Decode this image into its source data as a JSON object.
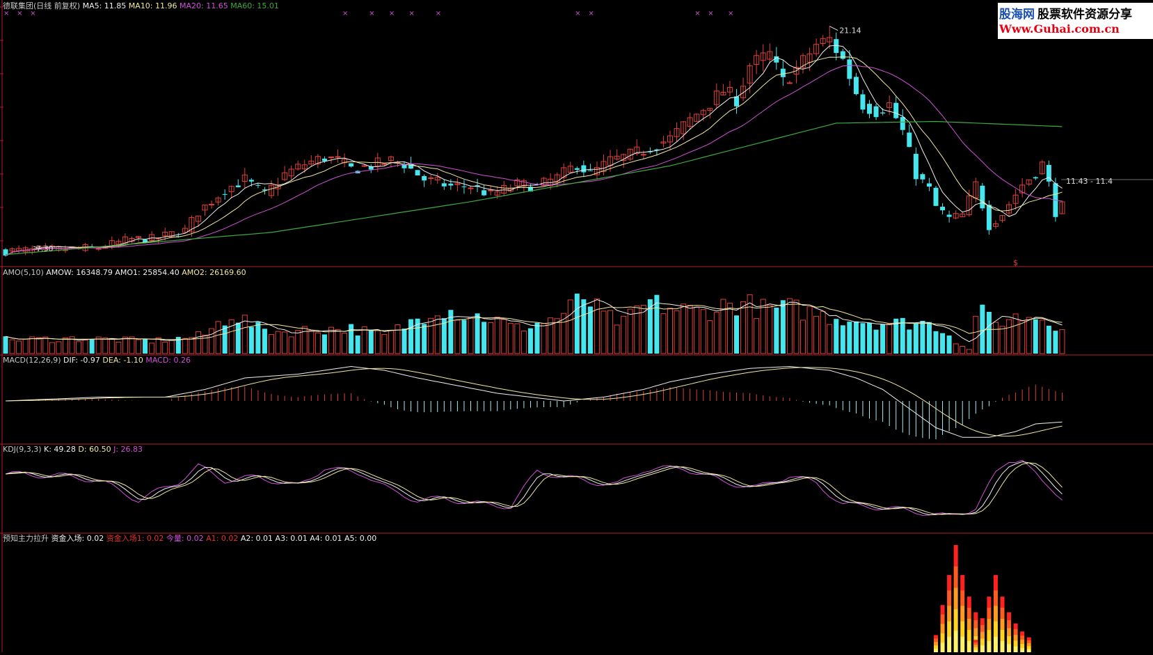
{
  "colors": {
    "bg": "#000000",
    "frame": "#b4222a",
    "up": "#e0403a",
    "down": "#46e6ef",
    "ma5": "#f0f0f0",
    "ma10": "#f3e9a0",
    "ma20": "#d052d8",
    "ma60": "#3faa3f",
    "yellow": "#e8e35a",
    "magenta": "#d052d8",
    "label": "#c8c8c8"
  },
  "watermark": {
    "brand_cn": "股海网",
    "slogan": "股票软件资源分享",
    "url": "Www.Guhai.com.cn"
  },
  "panels": {
    "main": {
      "title": "德联集团(日线 前复权)",
      "legend": [
        {
          "name": "MA5",
          "value": "11.85",
          "color": "#f0f0f0"
        },
        {
          "name": "MA10",
          "value": "11.96",
          "color": "#f3e9a0"
        },
        {
          "name": "MA20",
          "value": "11.65",
          "color": "#d052d8"
        },
        {
          "name": "MA60",
          "value": "15.01",
          "color": "#3faa3f"
        }
      ],
      "high_label": "21.14",
      "low_label": "7.30",
      "right_label": "11.43 - 11.4",
      "signal_mark": "$",
      "top_marks": [
        "×",
        "×",
        "×",
        "×",
        "×",
        "×",
        "×",
        "×",
        "×",
        "×",
        "×",
        "×",
        "×"
      ]
    },
    "amo": {
      "title": "AMO(5,10)",
      "legend": [
        {
          "name": "AMOW",
          "value": "16348.79",
          "color": "#f0f0f0"
        },
        {
          "name": "AMO1",
          "value": "25854.40",
          "color": "#f0f0f0"
        },
        {
          "name": "AMO2",
          "value": "26169.60",
          "color": "#f3e9a0"
        }
      ]
    },
    "macd": {
      "title": "MACD(12,26,9)",
      "legend": [
        {
          "name": "DIF",
          "value": "-0.97",
          "color": "#f0f0f0"
        },
        {
          "name": "DEA",
          "value": "-1.10",
          "color": "#f3e9a0"
        },
        {
          "name": "MACD",
          "value": "0.26",
          "color": "#d052d8"
        }
      ]
    },
    "kdj": {
      "title": "KDJ(9,3,3)",
      "legend": [
        {
          "name": "K",
          "value": "49.28",
          "color": "#f0f0f0"
        },
        {
          "name": "D",
          "value": "60.50",
          "color": "#f3e9a0"
        },
        {
          "name": "J",
          "value": "26.83",
          "color": "#d052d8"
        }
      ]
    },
    "fund": {
      "title": "预知主力拉升",
      "legend": [
        {
          "name": "资金入场",
          "value": "0.02",
          "color": "#f0f0f0"
        },
        {
          "name": "资金入场1",
          "value": "0.02",
          "color": "#e8302a"
        },
        {
          "name": "今量",
          "value": "0.02",
          "color": "#d052d8"
        },
        {
          "name": "A1",
          "value": "0.02",
          "color": "#e8302a"
        },
        {
          "name": "A2",
          "value": "0.01",
          "color": "#f0f0f0"
        },
        {
          "name": "A3",
          "value": "0.01",
          "color": "#f0f0f0"
        },
        {
          "name": "A4",
          "value": "0.01",
          "color": "#f0f0f0"
        },
        {
          "name": "A5",
          "value": "0.00",
          "color": "#f0f0f0"
        }
      ]
    }
  },
  "chart_data": {
    "type": "candlestick",
    "ylim": [
      7.0,
      21.6
    ],
    "anchor_price": [
      [
        0,
        7.7
      ],
      [
        8,
        7.8
      ],
      [
        14,
        7.9
      ],
      [
        19,
        8.4
      ],
      [
        22,
        8.4
      ],
      [
        27,
        8.9
      ],
      [
        29,
        10.0
      ],
      [
        33,
        11.3
      ],
      [
        36,
        11.9
      ],
      [
        39,
        11.0
      ],
      [
        42,
        12.2
      ],
      [
        45,
        12.8
      ],
      [
        48,
        13.2
      ],
      [
        50,
        13.0
      ],
      [
        52,
        12.5
      ],
      [
        55,
        12.7
      ],
      [
        58,
        13.0
      ],
      [
        60,
        12.8
      ],
      [
        63,
        11.9
      ],
      [
        67,
        11.5
      ],
      [
        70,
        11.5
      ],
      [
        73,
        11.0
      ],
      [
        77,
        11.6
      ],
      [
        80,
        11.5
      ],
      [
        83,
        12.0
      ],
      [
        86,
        12.8
      ],
      [
        88,
        12.2
      ],
      [
        91,
        13.0
      ],
      [
        93,
        13.2
      ],
      [
        96,
        13.6
      ],
      [
        100,
        14.3
      ],
      [
        103,
        15.4
      ],
      [
        106,
        16.4
      ],
      [
        108,
        17.1
      ],
      [
        110,
        16.6
      ],
      [
        112,
        18.6
      ],
      [
        115,
        19.2
      ],
      [
        117,
        17.6
      ],
      [
        120,
        18.8
      ],
      [
        122,
        19.8
      ],
      [
        124,
        20.1
      ],
      [
        126,
        18.9
      ],
      [
        128,
        17.0
      ],
      [
        129,
        16.3
      ],
      [
        131,
        15.9
      ],
      [
        133,
        16.3
      ],
      [
        135,
        14.7
      ],
      [
        137,
        12.2
      ],
      [
        139,
        11.3
      ],
      [
        140,
        10.3
      ],
      [
        142,
        9.6
      ],
      [
        144,
        9.8
      ],
      [
        146,
        11.6
      ],
      [
        148,
        9.2
      ],
      [
        150,
        9.9
      ],
      [
        153,
        11.6
      ],
      [
        155,
        12.3
      ],
      [
        156,
        12.8
      ],
      [
        157,
        11.6
      ],
      [
        158,
        10.0
      ],
      [
        159,
        10.3
      ]
    ],
    "ma60_anchors": [
      [
        0,
        7.5
      ],
      [
        40,
        8.8
      ],
      [
        70,
        10.6
      ],
      [
        100,
        12.7
      ],
      [
        125,
        15.2
      ],
      [
        140,
        15.3
      ],
      [
        159,
        15.0
      ]
    ],
    "amo_anchors": [
      [
        0,
        22
      ],
      [
        12,
        24
      ],
      [
        22,
        20
      ],
      [
        28,
        26
      ],
      [
        30,
        30
      ],
      [
        34,
        64
      ],
      [
        38,
        40
      ],
      [
        42,
        34
      ],
      [
        46,
        38
      ],
      [
        52,
        40
      ],
      [
        57,
        28
      ],
      [
        61,
        50
      ],
      [
        65,
        75
      ],
      [
        69,
        62
      ],
      [
        73,
        56
      ],
      [
        77,
        40
      ],
      [
        81,
        50
      ],
      [
        84,
        62
      ],
      [
        87,
        90
      ],
      [
        90,
        60
      ],
      [
        93,
        48
      ],
      [
        95,
        68
      ],
      [
        97,
        80
      ],
      [
        101,
        70
      ],
      [
        105,
        66
      ],
      [
        108,
        76
      ],
      [
        111,
        80
      ],
      [
        114,
        70
      ],
      [
        118,
        72
      ],
      [
        121,
        66
      ],
      [
        124,
        58
      ],
      [
        127,
        56
      ],
      [
        131,
        50
      ],
      [
        134,
        48
      ],
      [
        138,
        50
      ],
      [
        141,
        40
      ],
      [
        143,
        20
      ],
      [
        145,
        6
      ],
      [
        146,
        70
      ],
      [
        149,
        48
      ],
      [
        151,
        56
      ],
      [
        155,
        60
      ],
      [
        159,
        44
      ]
    ],
    "macd_anchors": [
      [
        0,
        0.0
      ],
      [
        14,
        0.1
      ],
      [
        24,
        0.1
      ],
      [
        30,
        0.3
      ],
      [
        36,
        0.6
      ],
      [
        44,
        0.7
      ],
      [
        52,
        0.9
      ],
      [
        57,
        0.8
      ],
      [
        62,
        0.6
      ],
      [
        68,
        0.4
      ],
      [
        74,
        0.2
      ],
      [
        79,
        0.1
      ],
      [
        84,
        0.0
      ],
      [
        90,
        0.1
      ],
      [
        96,
        0.3
      ],
      [
        100,
        0.5
      ],
      [
        106,
        0.7
      ],
      [
        112,
        0.85
      ],
      [
        118,
        0.9
      ],
      [
        124,
        0.8
      ],
      [
        128,
        0.6
      ],
      [
        132,
        0.3
      ],
      [
        136,
        -0.2
      ],
      [
        140,
        -0.7
      ],
      [
        144,
        -0.95
      ],
      [
        148,
        -0.95
      ],
      [
        152,
        -0.8
      ],
      [
        155,
        -0.6
      ],
      [
        159,
        -0.55
      ]
    ],
    "kdj_anchors": [
      [
        0,
        70
      ],
      [
        8,
        68
      ],
      [
        14,
        62
      ],
      [
        20,
        36
      ],
      [
        26,
        60
      ],
      [
        29,
        80
      ],
      [
        33,
        62
      ],
      [
        38,
        66
      ],
      [
        44,
        54
      ],
      [
        48,
        78
      ],
      [
        54,
        70
      ],
      [
        58,
        48
      ],
      [
        62,
        36
      ],
      [
        66,
        38
      ],
      [
        72,
        30
      ],
      [
        76,
        28
      ],
      [
        80,
        74
      ],
      [
        84,
        66
      ],
      [
        88,
        60
      ],
      [
        92,
        56
      ],
      [
        96,
        76
      ],
      [
        102,
        78
      ],
      [
        108,
        60
      ],
      [
        113,
        52
      ],
      [
        118,
        68
      ],
      [
        122,
        58
      ],
      [
        126,
        30
      ],
      [
        130,
        28
      ],
      [
        134,
        24
      ],
      [
        138,
        20
      ],
      [
        142,
        14
      ],
      [
        146,
        26
      ],
      [
        149,
        70
      ],
      [
        151,
        88
      ],
      [
        153,
        90
      ],
      [
        156,
        58
      ],
      [
        159,
        40
      ]
    ],
    "fund_spikes": [
      {
        "center": 143,
        "peak": 1.0
      },
      {
        "center": 149,
        "peak": 0.72
      }
    ]
  }
}
